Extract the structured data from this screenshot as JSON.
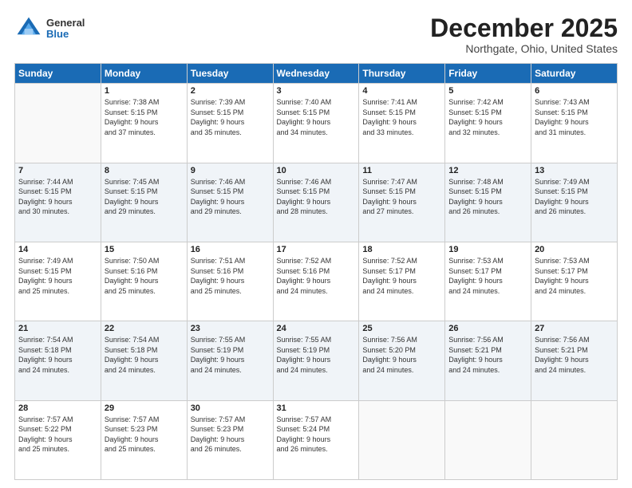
{
  "header": {
    "logo_general": "General",
    "logo_blue": "Blue",
    "month_year": "December 2025",
    "location": "Northgate, Ohio, United States"
  },
  "days_of_week": [
    "Sunday",
    "Monday",
    "Tuesday",
    "Wednesday",
    "Thursday",
    "Friday",
    "Saturday"
  ],
  "weeks": [
    [
      {
        "day": "",
        "info": ""
      },
      {
        "day": "1",
        "info": "Sunrise: 7:38 AM\nSunset: 5:15 PM\nDaylight: 9 hours\nand 37 minutes."
      },
      {
        "day": "2",
        "info": "Sunrise: 7:39 AM\nSunset: 5:15 PM\nDaylight: 9 hours\nand 35 minutes."
      },
      {
        "day": "3",
        "info": "Sunrise: 7:40 AM\nSunset: 5:15 PM\nDaylight: 9 hours\nand 34 minutes."
      },
      {
        "day": "4",
        "info": "Sunrise: 7:41 AM\nSunset: 5:15 PM\nDaylight: 9 hours\nand 33 minutes."
      },
      {
        "day": "5",
        "info": "Sunrise: 7:42 AM\nSunset: 5:15 PM\nDaylight: 9 hours\nand 32 minutes."
      },
      {
        "day": "6",
        "info": "Sunrise: 7:43 AM\nSunset: 5:15 PM\nDaylight: 9 hours\nand 31 minutes."
      }
    ],
    [
      {
        "day": "7",
        "info": "Sunrise: 7:44 AM\nSunset: 5:15 PM\nDaylight: 9 hours\nand 30 minutes."
      },
      {
        "day": "8",
        "info": "Sunrise: 7:45 AM\nSunset: 5:15 PM\nDaylight: 9 hours\nand 29 minutes."
      },
      {
        "day": "9",
        "info": "Sunrise: 7:46 AM\nSunset: 5:15 PM\nDaylight: 9 hours\nand 29 minutes."
      },
      {
        "day": "10",
        "info": "Sunrise: 7:46 AM\nSunset: 5:15 PM\nDaylight: 9 hours\nand 28 minutes."
      },
      {
        "day": "11",
        "info": "Sunrise: 7:47 AM\nSunset: 5:15 PM\nDaylight: 9 hours\nand 27 minutes."
      },
      {
        "day": "12",
        "info": "Sunrise: 7:48 AM\nSunset: 5:15 PM\nDaylight: 9 hours\nand 26 minutes."
      },
      {
        "day": "13",
        "info": "Sunrise: 7:49 AM\nSunset: 5:15 PM\nDaylight: 9 hours\nand 26 minutes."
      }
    ],
    [
      {
        "day": "14",
        "info": "Sunrise: 7:49 AM\nSunset: 5:15 PM\nDaylight: 9 hours\nand 25 minutes."
      },
      {
        "day": "15",
        "info": "Sunrise: 7:50 AM\nSunset: 5:16 PM\nDaylight: 9 hours\nand 25 minutes."
      },
      {
        "day": "16",
        "info": "Sunrise: 7:51 AM\nSunset: 5:16 PM\nDaylight: 9 hours\nand 25 minutes."
      },
      {
        "day": "17",
        "info": "Sunrise: 7:52 AM\nSunset: 5:16 PM\nDaylight: 9 hours\nand 24 minutes."
      },
      {
        "day": "18",
        "info": "Sunrise: 7:52 AM\nSunset: 5:17 PM\nDaylight: 9 hours\nand 24 minutes."
      },
      {
        "day": "19",
        "info": "Sunrise: 7:53 AM\nSunset: 5:17 PM\nDaylight: 9 hours\nand 24 minutes."
      },
      {
        "day": "20",
        "info": "Sunrise: 7:53 AM\nSunset: 5:17 PM\nDaylight: 9 hours\nand 24 minutes."
      }
    ],
    [
      {
        "day": "21",
        "info": "Sunrise: 7:54 AM\nSunset: 5:18 PM\nDaylight: 9 hours\nand 24 minutes."
      },
      {
        "day": "22",
        "info": "Sunrise: 7:54 AM\nSunset: 5:18 PM\nDaylight: 9 hours\nand 24 minutes."
      },
      {
        "day": "23",
        "info": "Sunrise: 7:55 AM\nSunset: 5:19 PM\nDaylight: 9 hours\nand 24 minutes."
      },
      {
        "day": "24",
        "info": "Sunrise: 7:55 AM\nSunset: 5:19 PM\nDaylight: 9 hours\nand 24 minutes."
      },
      {
        "day": "25",
        "info": "Sunrise: 7:56 AM\nSunset: 5:20 PM\nDaylight: 9 hours\nand 24 minutes."
      },
      {
        "day": "26",
        "info": "Sunrise: 7:56 AM\nSunset: 5:21 PM\nDaylight: 9 hours\nand 24 minutes."
      },
      {
        "day": "27",
        "info": "Sunrise: 7:56 AM\nSunset: 5:21 PM\nDaylight: 9 hours\nand 24 minutes."
      }
    ],
    [
      {
        "day": "28",
        "info": "Sunrise: 7:57 AM\nSunset: 5:22 PM\nDaylight: 9 hours\nand 25 minutes."
      },
      {
        "day": "29",
        "info": "Sunrise: 7:57 AM\nSunset: 5:23 PM\nDaylight: 9 hours\nand 25 minutes."
      },
      {
        "day": "30",
        "info": "Sunrise: 7:57 AM\nSunset: 5:23 PM\nDaylight: 9 hours\nand 26 minutes."
      },
      {
        "day": "31",
        "info": "Sunrise: 7:57 AM\nSunset: 5:24 PM\nDaylight: 9 hours\nand 26 minutes."
      },
      {
        "day": "",
        "info": ""
      },
      {
        "day": "",
        "info": ""
      },
      {
        "day": "",
        "info": ""
      }
    ]
  ]
}
